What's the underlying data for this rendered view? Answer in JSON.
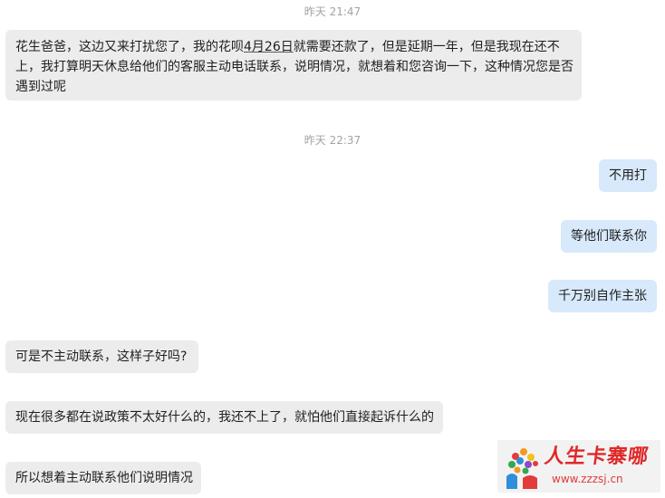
{
  "chat": {
    "timestamps": [
      {
        "text": "昨天 21:47"
      },
      {
        "text": "昨天 22:37"
      }
    ],
    "first_message": {
      "line1_pre": "花生爸爸，这边又来打扰您了，我的花呗",
      "line1_underlined": "4月26日",
      "line1_post": "就需要还款了，但是延期一年，但是我现在还不",
      "line2": "上，我打算明天休息给他们的客服主动电话联系，说明情况，就想着和您咨询一下，这种情况您是否",
      "line3": "遇到过呢"
    },
    "messages": [
      {
        "side": "out",
        "text": "不用打"
      },
      {
        "side": "out",
        "text": "等他们联系你"
      },
      {
        "side": "out",
        "text": "千万别自作主张"
      },
      {
        "side": "in",
        "text": "可是不主动联系，这样子好吗?"
      },
      {
        "side": "in",
        "text": "现在很多都在说政策不太好什么的，我还不上了，就怕他们直接起诉什么的"
      },
      {
        "side": "in",
        "text": "所以想着主动联系他们说明情况"
      }
    ]
  },
  "watermark": {
    "title": "人生卡寨哪",
    "url": "www.zzzsj.cn"
  },
  "colors": {
    "incoming_bubble": "#ececec",
    "outgoing_bubble": "#d7e9fb",
    "timestamp": "#a3a3a3",
    "watermark_red": "#e02828"
  }
}
